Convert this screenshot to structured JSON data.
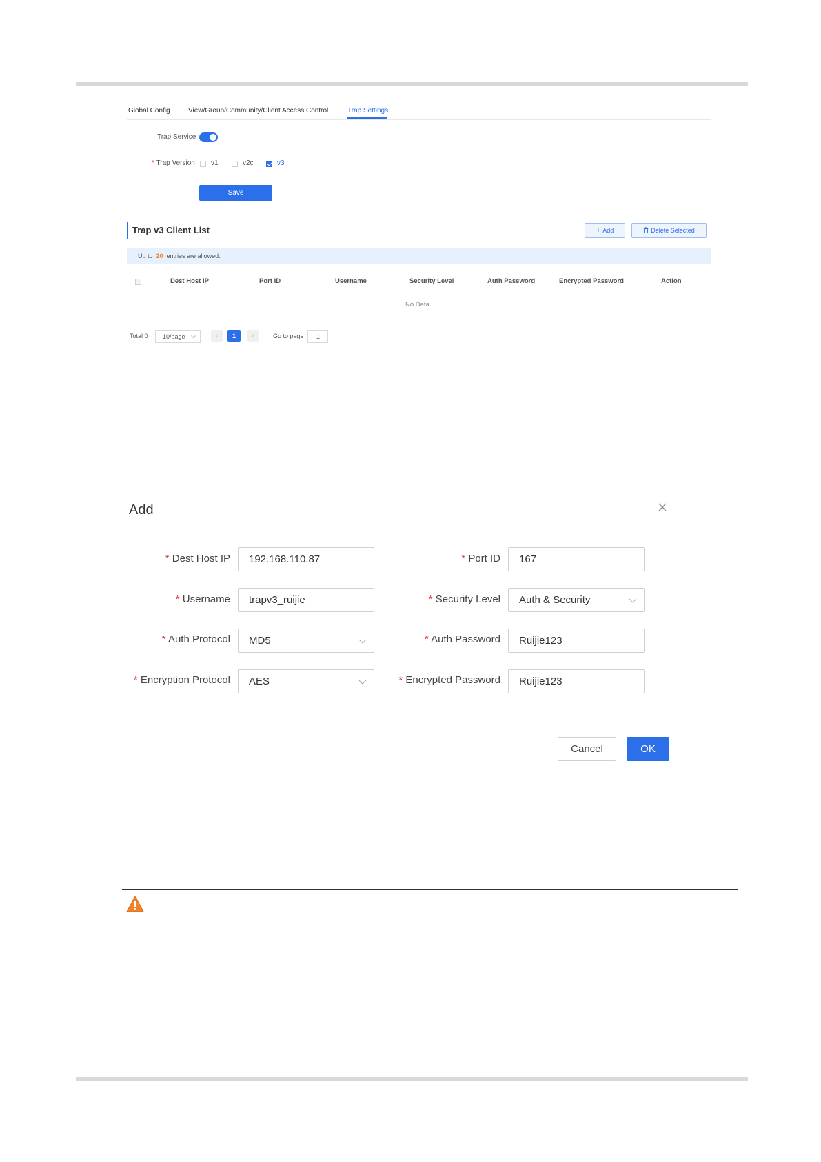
{
  "tabs": [
    {
      "label": "Global Config"
    },
    {
      "label": "View/Group/Community/Client Access Control"
    },
    {
      "label": "Trap Settings"
    }
  ],
  "trap_service": {
    "label": "Trap Service",
    "enabled": true
  },
  "trap_version": {
    "required_mark": "*",
    "label": "Trap Version",
    "options": [
      {
        "label": "v1",
        "checked": false
      },
      {
        "label": "v2c",
        "checked": false
      },
      {
        "label": "v3",
        "checked": true
      }
    ]
  },
  "save_label": "Save",
  "client_list": {
    "title": "Trap v3 Client List",
    "add_label": "Add",
    "delete_label": "Delete Selected",
    "info_prefix": "Up to",
    "info_count": "20",
    "info_suffix": "entries are allowed.",
    "columns": [
      "Dest Host IP",
      "Port ID",
      "Username",
      "Security Level",
      "Auth Password",
      "Encrypted Password",
      "Action"
    ],
    "empty_text": "No Data"
  },
  "pagination": {
    "total": "Total 0",
    "page_size": "10/page",
    "current_page": "1",
    "goto_label": "Go to page",
    "goto_value": "1"
  },
  "dialog": {
    "title": "Add",
    "required_mark": "*",
    "fields": {
      "dest_host_ip": {
        "label": "Dest Host IP",
        "value": "192.168.110.87"
      },
      "port_id": {
        "label": "Port ID",
        "value": "167"
      },
      "username": {
        "label": "Username",
        "value": "trapv3_ruijie"
      },
      "security_level": {
        "label": "Security Level",
        "value": "Auth & Security"
      },
      "auth_protocol": {
        "label": "Auth Protocol",
        "value": "MD5"
      },
      "auth_password": {
        "label": "Auth Password",
        "value": "Ruijie123"
      },
      "encryption_protocol": {
        "label": "Encryption Protocol",
        "value": "AES"
      },
      "encrypted_password": {
        "label": "Encrypted Password",
        "value": "Ruijie123"
      }
    },
    "cancel_label": "Cancel",
    "ok_label": "OK"
  },
  "colors": {
    "accent": "#2b6fea",
    "required": "#e03a3a",
    "warning": "#f0832a",
    "info_bg": "#e7f1fd"
  },
  "icons": [
    "plus-icon",
    "trash-icon",
    "close-icon",
    "chevron-down-icon",
    "warning-icon"
  ]
}
